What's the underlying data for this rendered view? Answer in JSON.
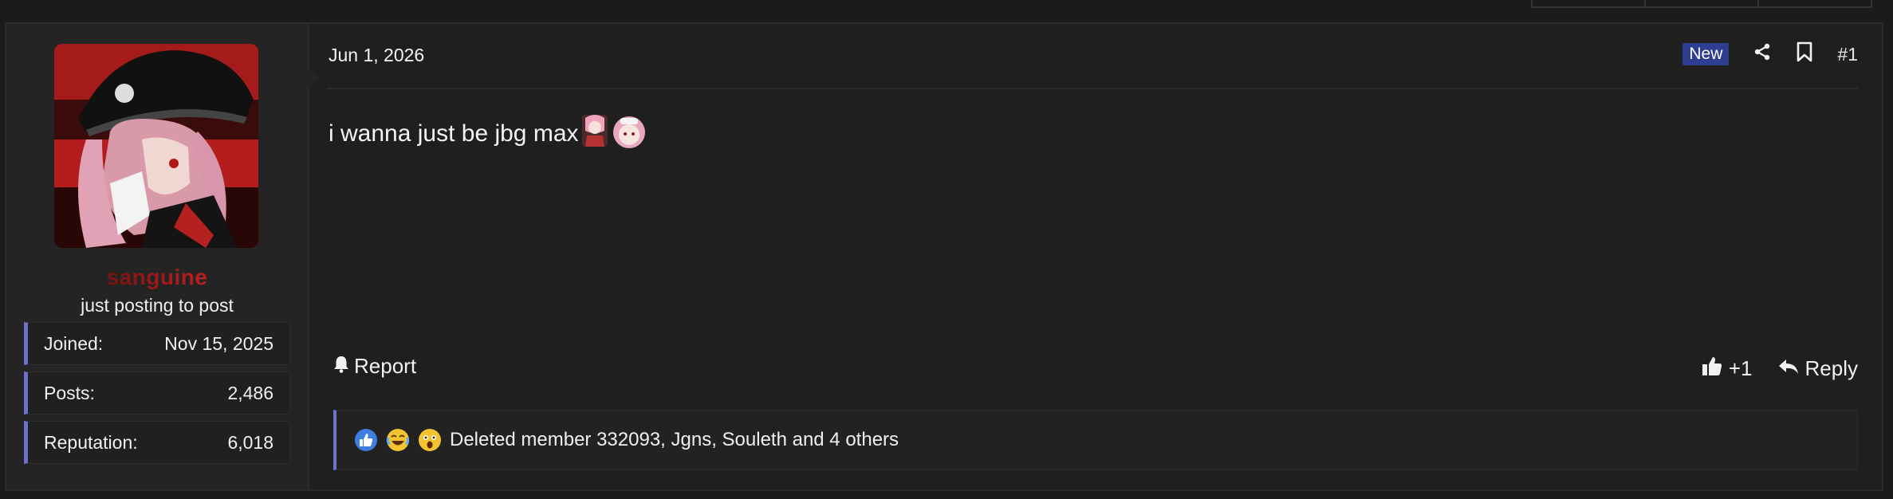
{
  "user": {
    "name": "sanguine",
    "title": "just posting to post",
    "stats": [
      {
        "label": "Joined:",
        "value": "Nov 15, 2025"
      },
      {
        "label": "Posts:",
        "value": "2,486"
      },
      {
        "label": "Reputation:",
        "value": "6,018"
      }
    ]
  },
  "post": {
    "date": "Jun 1, 2026",
    "badge": "New",
    "number": "#1",
    "message": "i wanna just be jbg max",
    "report_label": "Report",
    "like_label": "+1",
    "reply_label": "Reply",
    "reactions_text": "Deleted member 332093, Jgns, Souleth and 4 others"
  },
  "icons": {
    "share": "share-icon",
    "bookmark": "bookmark-icon",
    "bell": "bell-icon",
    "thumbs_up": "thumbs-up-icon",
    "reply": "reply-icon"
  },
  "colors": {
    "accent": "#6d73c9",
    "badge": "#2e3d8f",
    "username": "#c82020"
  }
}
